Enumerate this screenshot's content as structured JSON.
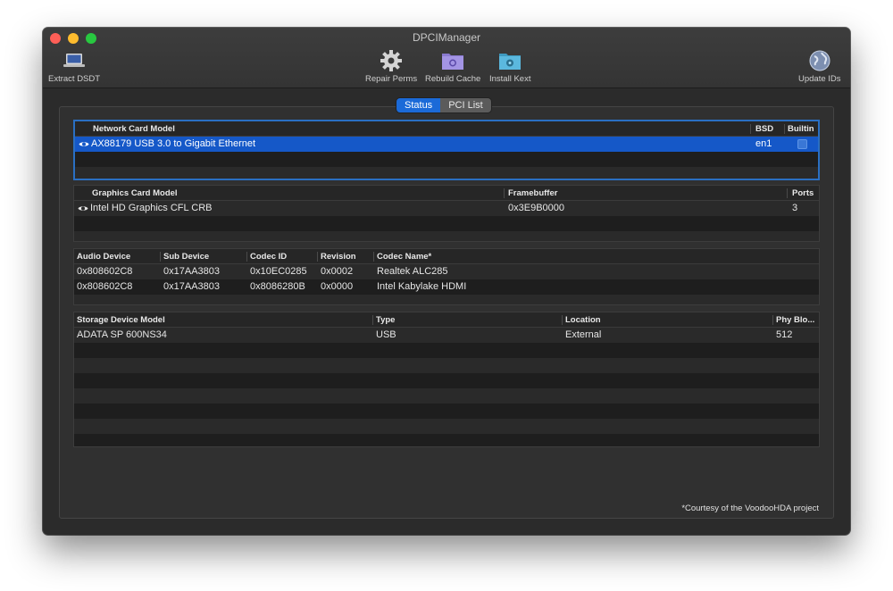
{
  "window": {
    "title": "DPCIManager"
  },
  "toolbar": {
    "extract": "Extract DSDT",
    "repair": "Repair Perms",
    "rebuild": "Rebuild Cache",
    "install": "Install Kext",
    "update": "Update IDs"
  },
  "tabs": {
    "status": "Status",
    "pci_list": "PCI List",
    "active": "Status"
  },
  "network": {
    "headers": {
      "model": "Network Card Model",
      "bsd": "BSD",
      "builtin": "Builtin"
    },
    "rows": [
      {
        "model": "AX88179 USB 3.0 to Gigabit Ethernet",
        "bsd": "en1",
        "builtin": false
      }
    ]
  },
  "graphics": {
    "headers": {
      "model": "Graphics Card Model",
      "framebuffer": "Framebuffer",
      "ports": "Ports"
    },
    "rows": [
      {
        "model": "Intel HD Graphics CFL CRB",
        "framebuffer": "0x3E9B0000",
        "ports": "3"
      }
    ]
  },
  "audio": {
    "headers": {
      "device": "Audio Device",
      "sub": "Sub Device",
      "codec_id": "Codec ID",
      "revision": "Revision",
      "codec_name": "Codec Name*"
    },
    "rows": [
      {
        "device": "0x808602C8",
        "sub": "0x17AA3803",
        "codec_id": "0x10EC0285",
        "revision": "0x0002",
        "codec_name": "Realtek ALC285"
      },
      {
        "device": "0x808602C8",
        "sub": "0x17AA3803",
        "codec_id": "0x8086280B",
        "revision": "0x0000",
        "codec_name": "Intel Kabylake HDMI"
      }
    ]
  },
  "storage": {
    "headers": {
      "model": "Storage Device Model",
      "type": "Type",
      "location": "Location",
      "phy": "Phy Blo..."
    },
    "rows": [
      {
        "model": "ADATA SP 600NS34",
        "type": "USB",
        "location": "External",
        "phy": "512"
      }
    ]
  },
  "footer": "*Courtesy of the VoodooHDA project",
  "colors": {
    "accent": "#1b6ad8",
    "selection": "#1558c8",
    "background": "#2b2b2b"
  }
}
